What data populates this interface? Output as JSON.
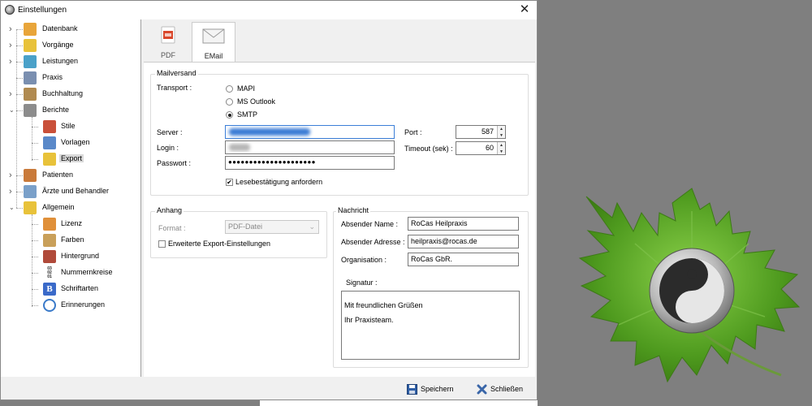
{
  "window": {
    "title": "Einstellungen",
    "close_glyph": "✕"
  },
  "tree": {
    "items": [
      {
        "label": "Datenbank",
        "icon": "database-icon"
      },
      {
        "label": "Vorgänge",
        "icon": "folder-icon"
      },
      {
        "label": "Leistungen",
        "icon": "tools-icon"
      },
      {
        "label": "Praxis",
        "icon": "building-icon"
      },
      {
        "label": "Buchhaltung",
        "icon": "ledger-icon"
      },
      {
        "label": "Berichte",
        "icon": "printer-icon"
      },
      {
        "label": "Stile",
        "icon": "brush-icon"
      },
      {
        "label": "Vorlagen",
        "icon": "template-icon"
      },
      {
        "label": "Export",
        "icon": "export-folder-icon"
      },
      {
        "label": "Patienten",
        "icon": "patients-icon"
      },
      {
        "label": "Ärzte und Behandler",
        "icon": "doctor-icon"
      },
      {
        "label": "Allgemein",
        "icon": "general-folder-icon"
      },
      {
        "label": "Lizenz",
        "icon": "license-icon"
      },
      {
        "label": "Farben",
        "icon": "palette-icon"
      },
      {
        "label": "Hintergrund",
        "icon": "background-icon"
      },
      {
        "label": "Nummernkreise",
        "icon": "number-ranges-icon"
      },
      {
        "label": "Schriftarten",
        "icon": "font-icon"
      },
      {
        "label": "Erinnerungen",
        "icon": "stopwatch-icon"
      }
    ],
    "number_icon_text": [
      "03",
      "02",
      "01"
    ],
    "font_icon_text": "B"
  },
  "tabs": [
    {
      "label": "PDF",
      "icon": "pdf-icon"
    },
    {
      "label": "EMail",
      "icon": "envelope-icon"
    }
  ],
  "mailversand": {
    "title": "Mailversand",
    "transport_label": "Transport :",
    "options": [
      "MAPI",
      "MS Outlook",
      "SMTP"
    ],
    "selected": "SMTP",
    "server_label": "Server :",
    "server_value": "",
    "login_label": "Login :",
    "login_value": "",
    "password_label": "Passwort :",
    "password_value": "●●●●●●●●●●●●●●●●●●●●●",
    "port_label": "Port :",
    "port_value": "587",
    "timeout_label": "Timeout (sek) :",
    "timeout_value": "60",
    "read_receipt_label": "Lesebestätigung anfordern",
    "read_receipt_checked": true
  },
  "anhang": {
    "title": "Anhang",
    "format_label": "Format :",
    "format_value": "PDF-Datei",
    "extended_label": "Erweiterte Export-Einstellungen",
    "extended_checked": false
  },
  "nachricht": {
    "title": "Nachricht",
    "sender_name_label": "Absender Name :",
    "sender_name_value": "RoCas Heilpraxis",
    "sender_address_label": "Absender Adresse :",
    "sender_address_value": "heilpraxis@rocas.de",
    "organisation_label": "Organisation :",
    "organisation_value": "RoCas GbR.",
    "signature_label": "Signatur :",
    "signature_lines": [
      "Mit freundlichen Grüßen",
      "Ihr Praxisteam."
    ]
  },
  "buttons": {
    "save": "Speichern",
    "close": "Schließen"
  },
  "colors": {
    "selection": "#d9d9d9",
    "blur_highlight": "#3a7bd5",
    "leaf_green": "#5aa02c",
    "background": "#7f7f7f"
  }
}
